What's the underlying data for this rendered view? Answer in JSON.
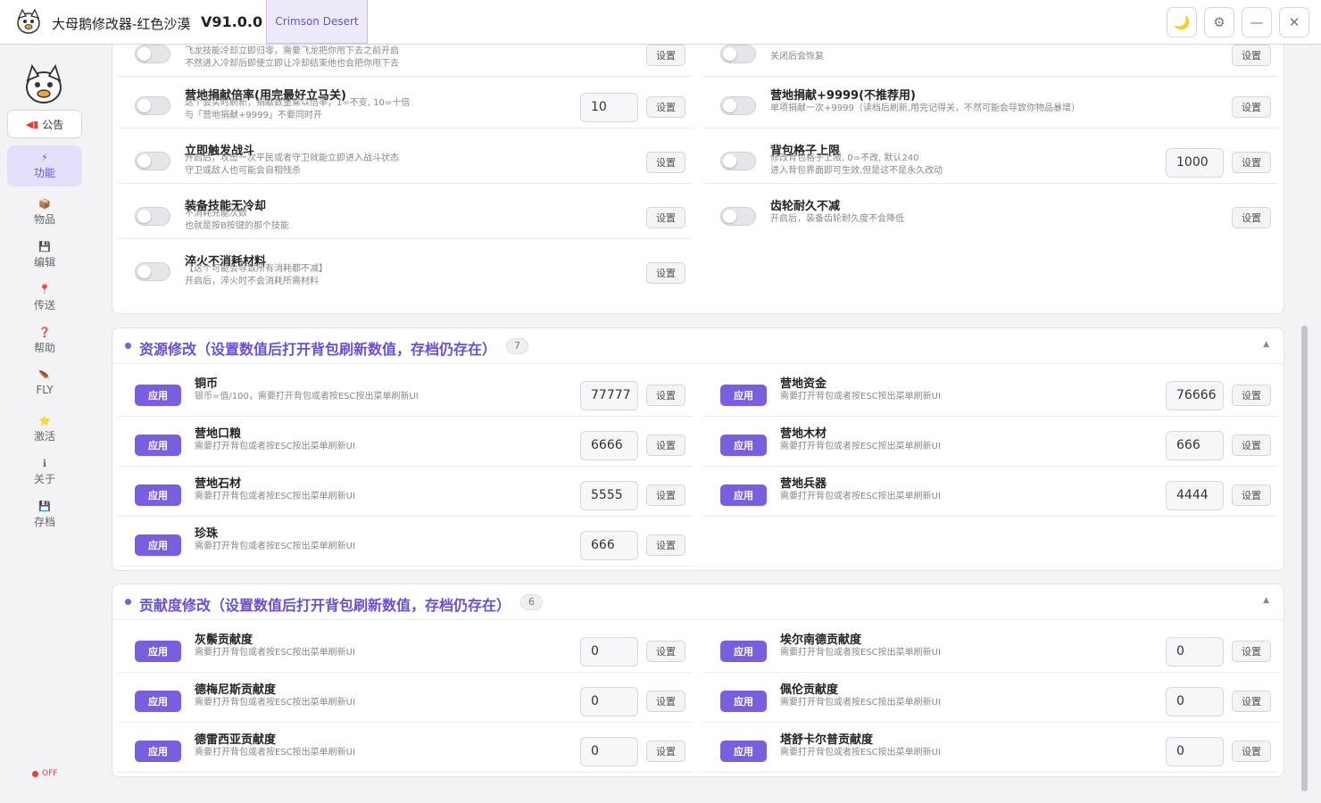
{
  "app": {
    "title": "大母鹅修改器-红色沙漠",
    "version": "V91.0.0",
    "game_tab": "Crimson Desert"
  },
  "window_buttons": [
    {
      "name": "theme-toggle-button",
      "icon": "moon-icon",
      "glyph": "🌙"
    },
    {
      "name": "settings-button",
      "icon": "gear-icon",
      "glyph": "⚙"
    },
    {
      "name": "minimize-button",
      "icon": "minimize-icon",
      "glyph": "—"
    },
    {
      "name": "close-button",
      "icon": "close-icon",
      "glyph": "✕"
    }
  ],
  "sidebar": {
    "notice_label": "公告",
    "items": [
      {
        "label": "功能",
        "icon": "lightning-icon",
        "glyph": "⚡",
        "active": true
      },
      {
        "label": "物品",
        "icon": "box-icon",
        "glyph": "📦"
      },
      {
        "label": "编辑",
        "icon": "floppy-icon",
        "glyph": "💾"
      },
      {
        "label": "传送",
        "icon": "pin-icon",
        "glyph": "📍"
      },
      {
        "label": "帮助",
        "icon": "question-icon",
        "glyph": "❓"
      },
      {
        "label": "FLY",
        "icon": "wing-icon",
        "glyph": "🪶"
      },
      {
        "label": "激活",
        "icon": "star-icon",
        "glyph": "⭐"
      },
      {
        "label": "关于",
        "icon": "info-icon",
        "glyph": "ℹ"
      },
      {
        "label": "存档",
        "icon": "save-icon",
        "glyph": "💾"
      }
    ],
    "status": "OFF"
  },
  "features": {
    "left": [
      {
        "title": "",
        "desc1": "飞龙技能冷却立即归零，需要飞龙把你甩下去之前开启",
        "desc2": "不然进入冷却后即使立即让冷却结束他也会把你甩下去",
        "value": null,
        "set": "设置"
      },
      {
        "title": "营地捐献倍率(用完最好立马关)",
        "desc1": "这个会实时刷新，捐献数量乘以倍率，1=不变, 10=十倍",
        "desc2": "与「营地捐献+9999」不要同时开",
        "value": "10",
        "set": "设置"
      },
      {
        "title": "立即触发战斗",
        "desc1": "开启后，攻击一次平民或者守卫就能立即进入战斗状态",
        "desc2": "守卫或敌人也可能会自相残杀",
        "value": null,
        "set": "设置"
      },
      {
        "title": "装备技能无冷却",
        "desc1": "不消耗充能次数",
        "desc2": "也就是按B按键的那个技能",
        "value": null,
        "set": "设置"
      },
      {
        "title": "淬火不消耗材料",
        "desc1": "【这个可能会导致所有消耗都不减】",
        "desc2": "开启后，淬火时不会消耗所需材料",
        "value": null,
        "set": "设置"
      }
    ],
    "right": [
      {
        "title": "",
        "desc1": "关闭后会恢复",
        "desc2": "",
        "value": null,
        "set": "设置"
      },
      {
        "title": "营地捐献+9999(不推荐用)",
        "desc1": "单项捐献一次+9999（读档后刷新,用完记得关，不然可能会导致你物品暴增）",
        "desc2": "",
        "value": null,
        "set": "设置"
      },
      {
        "title": "背包格子上限",
        "desc1": "修改背包格子上限, 0=不改, 默认240",
        "desc2": "进入背包界面即可生效,但是这不是永久改动",
        "value": "1000",
        "set": "设置"
      },
      {
        "title": "齿轮耐久不减",
        "desc1": "开启后，装备齿轮耐久度不会降低",
        "desc2": "",
        "value": null,
        "set": "设置"
      }
    ]
  },
  "resources": {
    "title": "资源修改（设置数值后打开背包刷新数值，存档仍存在）",
    "count": "7",
    "apply": "应用",
    "left": [
      {
        "title": "铜币",
        "desc": "银币=值/100，需要打开背包或者按ESC按出菜单刷新UI",
        "value": "77777",
        "set": "设置"
      },
      {
        "title": "营地口粮",
        "desc": "需要打开背包或者按ESC按出菜单刷新UI",
        "value": "6666",
        "set": "设置"
      },
      {
        "title": "营地石材",
        "desc": "需要打开背包或者按ESC按出菜单刷新UI",
        "value": "5555",
        "set": "设置"
      },
      {
        "title": "珍珠",
        "desc": "需要打开背包或者按ESC按出菜单刷新UI",
        "value": "666",
        "set": "设置"
      }
    ],
    "right": [
      {
        "title": "营地资金",
        "desc": "需要打开背包或者按ESC按出菜单刷新UI",
        "value": "76666",
        "set": "设置"
      },
      {
        "title": "营地木材",
        "desc": "需要打开背包或者按ESC按出菜单刷新UI",
        "value": "666",
        "set": "设置"
      },
      {
        "title": "营地兵器",
        "desc": "需要打开背包或者按ESC按出菜单刷新UI",
        "value": "4444",
        "set": "设置"
      }
    ]
  },
  "contribution": {
    "title": "贡献度修改（设置数值后打开背包刷新数值，存档仍存在）",
    "count": "6",
    "apply": "应用",
    "left": [
      {
        "title": "灰鬃贡献度",
        "desc": "需要打开背包或者按ESC按出菜单刷新UI",
        "value": "0",
        "set": "设置"
      },
      {
        "title": "德梅尼斯贡献度",
        "desc": "需要打开背包或者按ESC按出菜单刷新UI",
        "value": "0",
        "set": "设置"
      },
      {
        "title": "德雷西亚贡献度",
        "desc": "需要打开背包或者按ESC按出菜单刷新UI",
        "value": "0",
        "set": "设置"
      }
    ],
    "right": [
      {
        "title": "埃尔南德贡献度",
        "desc": "需要打开背包或者按ESC按出菜单刷新UI",
        "value": "0",
        "set": "设置"
      },
      {
        "title": "佩伦贡献度",
        "desc": "需要打开背包或者按ESC按出菜单刷新UI",
        "value": "0",
        "set": "设置"
      },
      {
        "title": "塔舒卡尔普贡献度",
        "desc": "需要打开背包或者按ESC按出菜单刷新UI",
        "value": "0",
        "set": "设置"
      }
    ]
  },
  "colors": {
    "accent": "#7a5ee0",
    "accent_text": "#6b4fd0",
    "status_off": "#e0413a"
  }
}
